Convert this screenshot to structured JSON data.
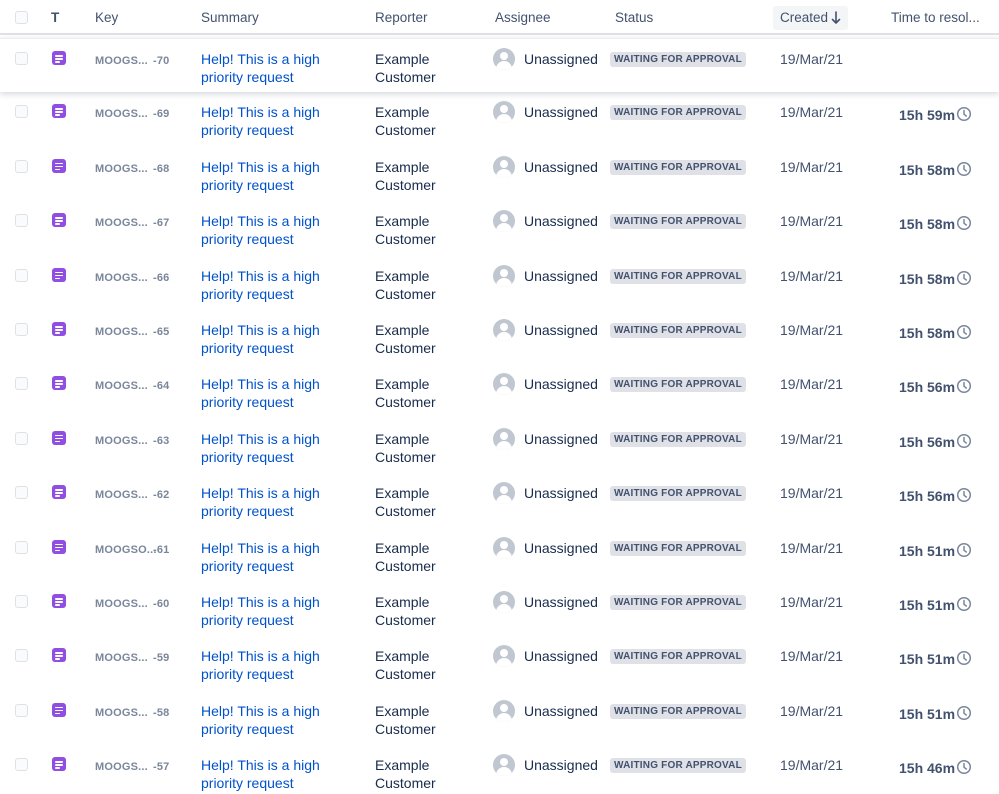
{
  "table": {
    "columns": {
      "type": "T",
      "key": "Key",
      "summary": "Summary",
      "reporter": "Reporter",
      "assignee": "Assignee",
      "status": "Status",
      "created": "Created",
      "time_to_resolution": "Time to resol..."
    },
    "sort": {
      "column": "Created",
      "direction": "descending",
      "icon": "arrow-down-icon"
    },
    "rows": [
      {
        "key_prefix": "MOOGS...",
        "key_num": "-70",
        "summary": "Help! This is a high priority request",
        "reporter": "Example Customer",
        "assignee": "Unassigned",
        "status": "WAITING FOR APPROVAL",
        "created": "19/Mar/21",
        "ttr": ""
      },
      {
        "key_prefix": "MOOGS...",
        "key_num": "-69",
        "summary": "Help! This is a high priority request",
        "reporter": "Example Customer",
        "assignee": "Unassigned",
        "status": "WAITING FOR APPROVAL",
        "created": "19/Mar/21",
        "ttr": "15h 59m"
      },
      {
        "key_prefix": "MOOGS...",
        "key_num": "-68",
        "summary": "Help! This is a high priority request",
        "reporter": "Example Customer",
        "assignee": "Unassigned",
        "status": "WAITING FOR APPROVAL",
        "created": "19/Mar/21",
        "ttr": "15h 58m"
      },
      {
        "key_prefix": "MOOGS...",
        "key_num": "-67",
        "summary": "Help! This is a high priority request",
        "reporter": "Example Customer",
        "assignee": "Unassigned",
        "status": "WAITING FOR APPROVAL",
        "created": "19/Mar/21",
        "ttr": "15h 58m"
      },
      {
        "key_prefix": "MOOGS...",
        "key_num": "-66",
        "summary": "Help! This is a high priority request",
        "reporter": "Example Customer",
        "assignee": "Unassigned",
        "status": "WAITING FOR APPROVAL",
        "created": "19/Mar/21",
        "ttr": "15h 58m"
      },
      {
        "key_prefix": "MOOGS...",
        "key_num": "-65",
        "summary": "Help! This is a high priority request",
        "reporter": "Example Customer",
        "assignee": "Unassigned",
        "status": "WAITING FOR APPROVAL",
        "created": "19/Mar/21",
        "ttr": "15h 58m"
      },
      {
        "key_prefix": "MOOGS...",
        "key_num": "-64",
        "summary": "Help! This is a high priority request",
        "reporter": "Example Customer",
        "assignee": "Unassigned",
        "status": "WAITING FOR APPROVAL",
        "created": "19/Mar/21",
        "ttr": "15h 56m"
      },
      {
        "key_prefix": "MOOGS...",
        "key_num": "-63",
        "summary": "Help! This is a high priority request",
        "reporter": "Example Customer",
        "assignee": "Unassigned",
        "status": "WAITING FOR APPROVAL",
        "created": "19/Mar/21",
        "ttr": "15h 56m"
      },
      {
        "key_prefix": "MOOGS...",
        "key_num": "-62",
        "summary": "Help! This is a high priority request",
        "reporter": "Example Customer",
        "assignee": "Unassigned",
        "status": "WAITING FOR APPROVAL",
        "created": "19/Mar/21",
        "ttr": "15h 56m"
      },
      {
        "key_prefix": "MOOGSO...",
        "key_num": "-61",
        "summary": "Help! This is a high priority request",
        "reporter": "Example Customer",
        "assignee": "Unassigned",
        "status": "WAITING FOR APPROVAL",
        "created": "19/Mar/21",
        "ttr": "15h 51m"
      },
      {
        "key_prefix": "MOOGS...",
        "key_num": "-60",
        "summary": "Help! This is a high priority request",
        "reporter": "Example Customer",
        "assignee": "Unassigned",
        "status": "WAITING FOR APPROVAL",
        "created": "19/Mar/21",
        "ttr": "15h 51m"
      },
      {
        "key_prefix": "MOOGS...",
        "key_num": "-59",
        "summary": "Help! This is a high priority request",
        "reporter": "Example Customer",
        "assignee": "Unassigned",
        "status": "WAITING FOR APPROVAL",
        "created": "19/Mar/21",
        "ttr": "15h 51m"
      },
      {
        "key_prefix": "MOOGS...",
        "key_num": "-58",
        "summary": "Help! This is a high priority request",
        "reporter": "Example Customer",
        "assignee": "Unassigned",
        "status": "WAITING FOR APPROVAL",
        "created": "19/Mar/21",
        "ttr": "15h 51m"
      },
      {
        "key_prefix": "MOOGS...",
        "key_num": "-57",
        "summary": "Help! This is a high priority request",
        "reporter": "Example Customer",
        "assignee": "Unassigned",
        "status": "WAITING FOR APPROVAL",
        "created": "19/Mar/21",
        "ttr": "15h 46m"
      }
    ]
  },
  "icons": {
    "type": "service-request-icon",
    "assignee": "unassigned-avatar-icon",
    "ttr": "clock-icon"
  },
  "colors": {
    "link": "#0052cc",
    "type_icon": "#904ee2",
    "status_badge_bg": "#dfe1e6"
  }
}
